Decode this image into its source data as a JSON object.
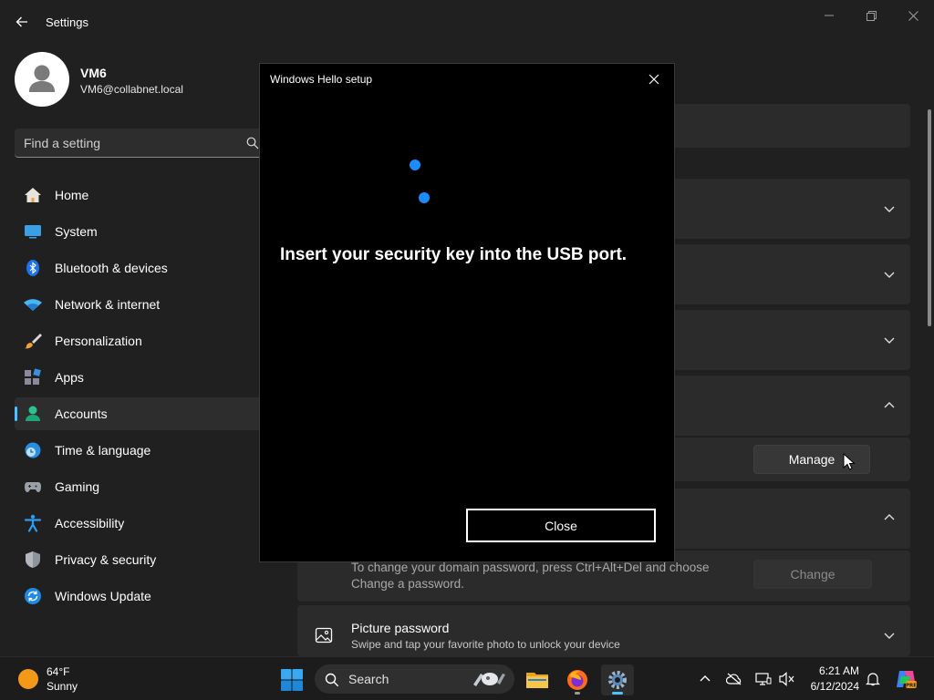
{
  "window": {
    "title": "Settings",
    "back_icon": "back-arrow-icon",
    "controls": [
      "minimize-icon",
      "maximize-icon",
      "close-icon"
    ]
  },
  "profile": {
    "name": "VM6",
    "email": "VM6@collabnet.local"
  },
  "search": {
    "placeholder": "Find a setting",
    "value": ""
  },
  "sidebar": {
    "items": [
      {
        "label": "Home",
        "icon": "home-icon",
        "active": false
      },
      {
        "label": "System",
        "icon": "system-icon",
        "active": false
      },
      {
        "label": "Bluetooth & devices",
        "icon": "bluetooth-icon",
        "active": false
      },
      {
        "label": "Network & internet",
        "icon": "wifi-icon",
        "active": false
      },
      {
        "label": "Personalization",
        "icon": "brush-icon",
        "active": false
      },
      {
        "label": "Apps",
        "icon": "apps-icon",
        "active": false
      },
      {
        "label": "Accounts",
        "icon": "accounts-icon",
        "active": true
      },
      {
        "label": "Time & language",
        "icon": "time-language-icon",
        "active": false
      },
      {
        "label": "Gaming",
        "icon": "gamepad-icon",
        "active": false
      },
      {
        "label": "Accessibility",
        "icon": "accessibility-icon",
        "active": false
      },
      {
        "label": "Privacy & security",
        "icon": "shield-icon",
        "active": false
      },
      {
        "label": "Windows Update",
        "icon": "update-icon",
        "active": false
      }
    ]
  },
  "main": {
    "manage_label": "Manage",
    "password_text": "To change your domain password, press Ctrl+Alt+Del and choose Change a password.",
    "change_label": "Change",
    "picture_password": {
      "title": "Picture password",
      "description": "Swipe and tap your favorite photo to unlock your device"
    }
  },
  "dialog": {
    "title": "Windows Hello setup",
    "message": "Insert your security key into the USB port.",
    "close_label": "Close"
  },
  "taskbar": {
    "weather": {
      "temp": "64°F",
      "condition": "Sunny"
    },
    "search_label": "Search",
    "clock": {
      "time": "6:21 AM",
      "date": "6/12/2024"
    }
  },
  "colors": {
    "accent": "#4cc2ff",
    "dialog_dot": "#1a8cff",
    "background": "#202020"
  }
}
